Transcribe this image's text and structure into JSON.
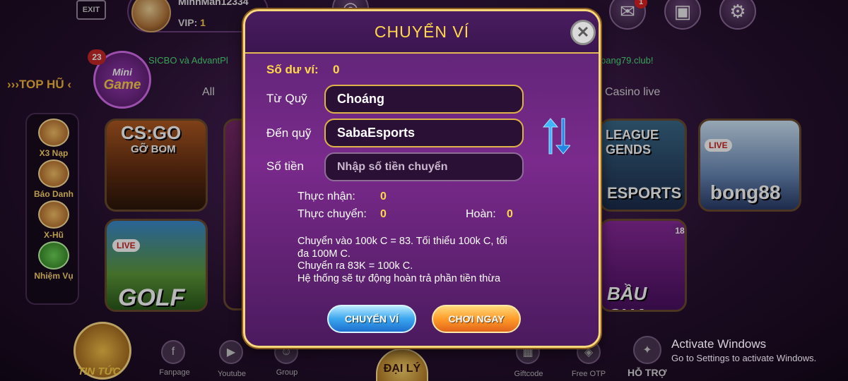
{
  "topbar": {
    "exit_label": "EXIT",
    "username": "MinhMan12334",
    "vip_label": "VIP:",
    "vip_level": "1",
    "mail_badge": "1"
  },
  "marquee": {
    "left_text": "SICBO và AdvantPl",
    "right_text": "bang79.club!"
  },
  "minigame": {
    "badge": "23",
    "line1": "Mini",
    "line2": "Game"
  },
  "top_hu_label": "TOP HŨ",
  "tabs": {
    "all": "All",
    "casino_live": "Casino live"
  },
  "sidebar": {
    "items": [
      {
        "label": "X3 Nạp"
      },
      {
        "label": "Báo Danh"
      },
      {
        "label": "X-Hũ"
      },
      {
        "label": "Nhiệm Vụ"
      }
    ]
  },
  "tiles": {
    "csgo_title": "CS:GO",
    "csgo_sub": "GỠ BOM",
    "golf_title": "GOLF",
    "live_label": "LIVE",
    "league_title": "LEAGUE GENDS",
    "esports_title": "ESPORTS",
    "bong88_title": "bong88",
    "baucua_title": "BẦU CUA",
    "baucua_badge": "18"
  },
  "bottom": {
    "news": "TIN TỨC",
    "fanpage": "Fanpage",
    "youtube": "Youtube",
    "group": "Group",
    "daily": "ĐẠI LÝ",
    "giftcode": "Giftcode",
    "freeotp": "Free OTP",
    "support": "HỖ TRỢ"
  },
  "windows": {
    "activate_title": "Activate Windows",
    "activate_sub": "Go to Settings to activate Windows."
  },
  "modal": {
    "title": "CHUYỂN VÍ",
    "balance_label": "Số dư ví:",
    "balance_value": "0",
    "from_label": "Từ Quỹ",
    "from_value": "Choáng",
    "to_label": "Đến quỹ",
    "to_value": "SabaEsports",
    "amount_label": "Số tiền",
    "amount_placeholder": "Nhập số tiền chuyển",
    "received_label": "Thực nhận:",
    "received_value": "0",
    "transferred_label": "Thực chuyển:",
    "transferred_value": "0",
    "refund_label": "Hoàn:",
    "refund_value": "0",
    "note_lines": [
      "Chuyển vào 100k C = 83. Tối thiểu 100k C, tối",
      "đa 100M C.",
      "Chuyển ra 83K = 100k C.",
      "Hệ thống sẽ tự động hoàn trả phần tiền thừa"
    ],
    "transfer_button": "CHUYỂN VÍ",
    "play_button": "CHƠI NGAY"
  },
  "colors": {
    "accent_gold": "#ffd84a",
    "modal_border": "#f6d77a",
    "blue_button": "#3aa6ee",
    "orange_button": "#ff9c2a"
  }
}
